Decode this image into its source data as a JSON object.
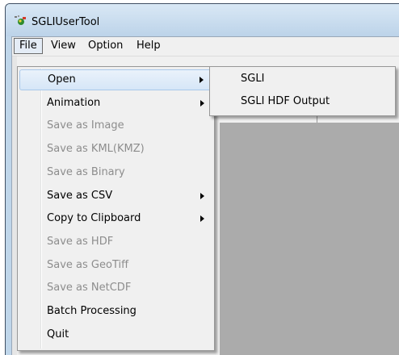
{
  "window": {
    "title": "SGLIUserTool"
  },
  "menubar": [
    "File",
    "View",
    "Option",
    "Help"
  ],
  "file_menu": [
    {
      "label": "Open",
      "enabled": true,
      "submenu": true,
      "highlighted": true
    },
    {
      "label": "Animation",
      "enabled": true,
      "submenu": true
    },
    {
      "label": "Save as Image",
      "enabled": false
    },
    {
      "label": "Save as KML(KMZ)",
      "enabled": false
    },
    {
      "label": "Save as Binary",
      "enabled": false
    },
    {
      "label": "Save as CSV",
      "enabled": true,
      "submenu": true
    },
    {
      "label": "Copy to Clipboard",
      "enabled": true,
      "submenu": true
    },
    {
      "label": "Save as HDF",
      "enabled": false
    },
    {
      "label": "Save as GeoTiff",
      "enabled": false
    },
    {
      "label": "Save as NetCDF",
      "enabled": false
    },
    {
      "label": "Batch Processing",
      "enabled": true
    },
    {
      "label": "Quit",
      "enabled": true
    }
  ],
  "open_submenu": [
    "SGLI",
    "SGLI HDF Output"
  ],
  "icons": {
    "app": "satellite-app-icon",
    "submenu_arrow": "submenu-arrow-icon"
  },
  "colors": {
    "title_bg": "#bcd3e9",
    "menu_bg": "#f0f0f0",
    "canvas": "#ababab",
    "disabled_text": "#8d8d8d"
  }
}
